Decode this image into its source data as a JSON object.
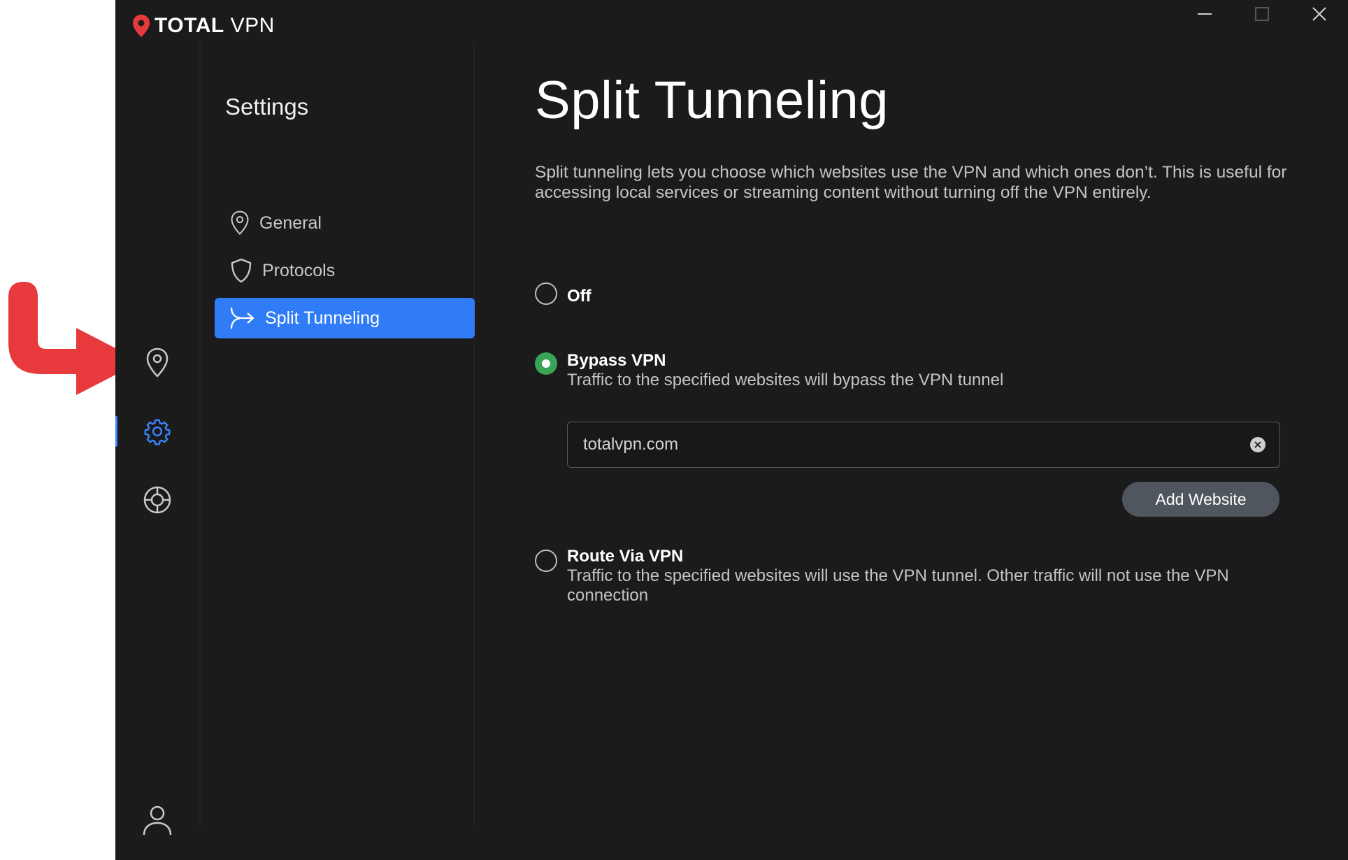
{
  "app": {
    "brand_bold": "TOTAL",
    "brand_light": "VPN"
  },
  "colors": {
    "accent": "#2f7cf6",
    "selected_radio": "#3aa556",
    "annotation": "#e8393d"
  },
  "rail": {
    "items": [
      {
        "icon": "location-pin-icon"
      },
      {
        "icon": "gear-icon",
        "active": true
      },
      {
        "icon": "lifebuoy-icon"
      },
      {
        "icon": "user-icon"
      }
    ]
  },
  "settings": {
    "title": "Settings",
    "menu": [
      {
        "label": "General",
        "icon": "location-pin-icon"
      },
      {
        "label": "Protocols",
        "icon": "shield-icon"
      },
      {
        "label": "Split Tunneling",
        "icon": "split-arrow-icon",
        "active": true
      }
    ]
  },
  "main": {
    "title": "Split Tunneling",
    "description": "Split tunneling lets you choose which websites use the VPN and which ones don’t. This is useful for accessing local services or streaming content without turning off the VPN entirely.",
    "options": [
      {
        "label": "Off",
        "selected": false
      },
      {
        "label": "Bypass VPN",
        "sub": "Traffic to the specified websites will bypass the VPN tunnel",
        "selected": true
      },
      {
        "label": "Route Via VPN",
        "sub": "Traffic to the specified websites will use the VPN tunnel. Other traffic will not use the VPN connection",
        "selected": false
      }
    ],
    "website_value": "totalvpn.com",
    "add_button": "Add Website"
  }
}
